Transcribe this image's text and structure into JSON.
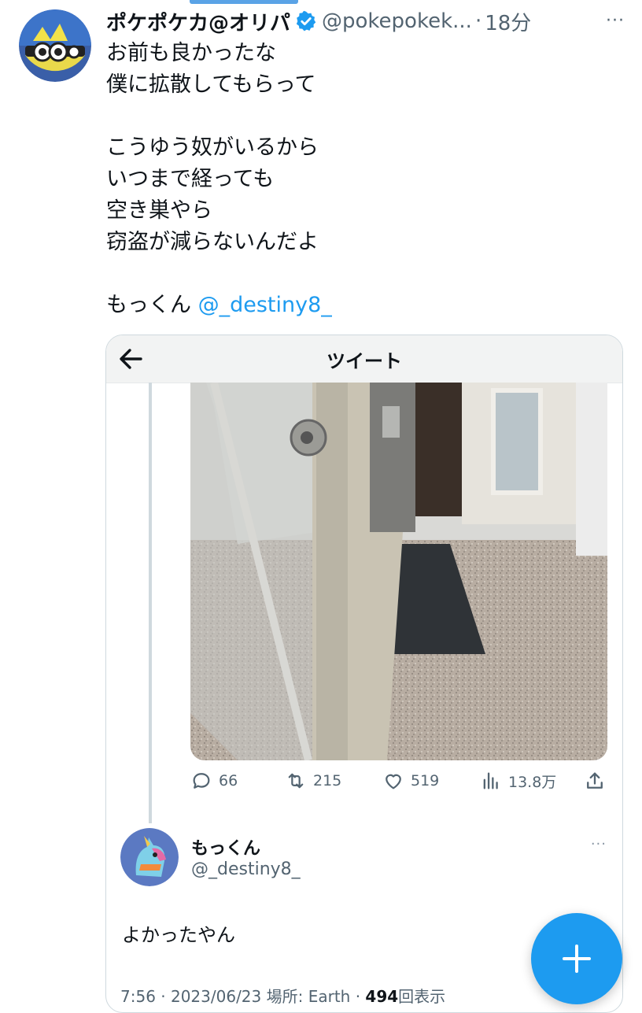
{
  "tweet": {
    "display_name": "ポケポケカ@オリパ",
    "handle": "@pokepokek...",
    "separator": "·",
    "time": "18分",
    "more": "···",
    "lines": [
      "お前も良かったな",
      "僕に拡散してもらって",
      "",
      "こうゆう奴がいるから",
      "いつまで経っても",
      "空き巣やら",
      "窃盗が減らないんだよ",
      "",
      "もっくん "
    ],
    "mention": "@_destiny8_",
    "verified_icon": "verified-badge-icon"
  },
  "embedded": {
    "header_title": "ツイート",
    "back_icon": "back-arrow-icon",
    "actions": {
      "replies": "66",
      "retweets": "215",
      "likes": "519",
      "views": "13.8万"
    },
    "reply": {
      "display_name": "もっくん",
      "handle": "@_destiny8_",
      "more": "···",
      "text": "よかったやん",
      "meta_prefix": "7:56 · 2023/06/23 場所: Earth · ",
      "view_count": "494",
      "meta_suffix": "回表示"
    }
  },
  "fab": {
    "icon": "plus-icon"
  },
  "colors": {
    "accent": "#1d9bf0",
    "muted": "#536471",
    "text": "#0f1419"
  }
}
